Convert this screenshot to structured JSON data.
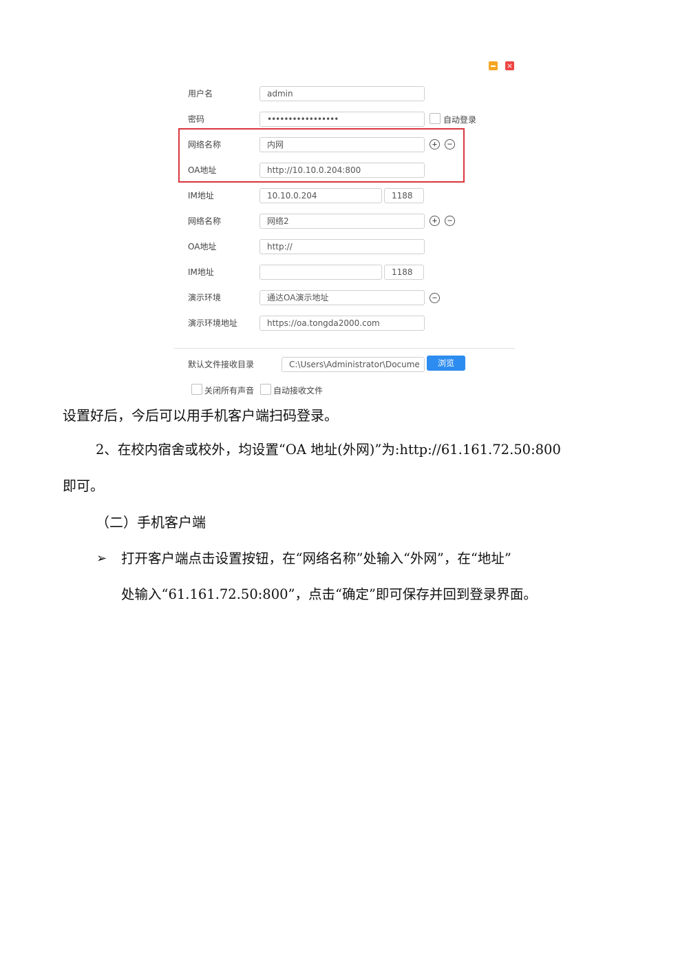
{
  "window": {
    "close_glyph": "×"
  },
  "form": {
    "username": {
      "label": "用户名",
      "value": "admin"
    },
    "password": {
      "label": "密码",
      "value": "•••••••••••••••••"
    },
    "auto_login": {
      "label": "自动登录",
      "checked": false
    },
    "network_1": {
      "name_label": "网络名称",
      "name_value": "内网",
      "oa_label": "OA地址",
      "oa_value": "http://10.10.0.204:800",
      "im_label": "IM地址",
      "im_value": "10.10.0.204",
      "im_port": "1188"
    },
    "network_2": {
      "name_label": "网络名称",
      "name_value": "网络2",
      "oa_label": "OA地址",
      "oa_value": "http://",
      "im_label": "IM地址",
      "im_value": "",
      "im_port": "1188"
    },
    "demo": {
      "env_label": "演示环境",
      "env_value": "通达OA演示地址",
      "addr_label": "演示环境地址",
      "addr_value": "https://oa.tongda2000.com"
    },
    "download_dir": {
      "label": "默认文件接收目录",
      "value": "C:\\Users\\Administrator\\Docume",
      "browse_label": "浏览"
    },
    "mute_all": {
      "label": "关闭所有声音",
      "checked": false
    },
    "auto_receive": {
      "label": "自动接收文件",
      "checked": false
    },
    "add_glyph": "+",
    "remove_glyph": "−"
  },
  "document": {
    "line1": "设置好后，今后可以用手机客户端扫码登录。",
    "line2": "2、在校内宿舍或校外，均设置“OA 地址(外网)”为:http://61.161.72.50:800",
    "line3": "即可。",
    "section_heading": "（二）手机客户端",
    "bullet_glyph": "➢",
    "bullet_line1": "打开客户端点击设置按钮，在“网络名称”处输入“外网”，在“地址”",
    "bullet_line2": "处输入“61.161.72.50:800”，点击“确定”即可保存并回到登录界面。"
  },
  "colors": {
    "highlight_border": "#d9363e",
    "browse_button": "#2d8cf0",
    "minimize_button": "#f5a623",
    "close_button": "#ee4444"
  },
  "icons": [
    "minimize-icon",
    "close-icon",
    "add-circle-icon",
    "remove-circle-icon",
    "bullet-arrow-icon"
  ]
}
